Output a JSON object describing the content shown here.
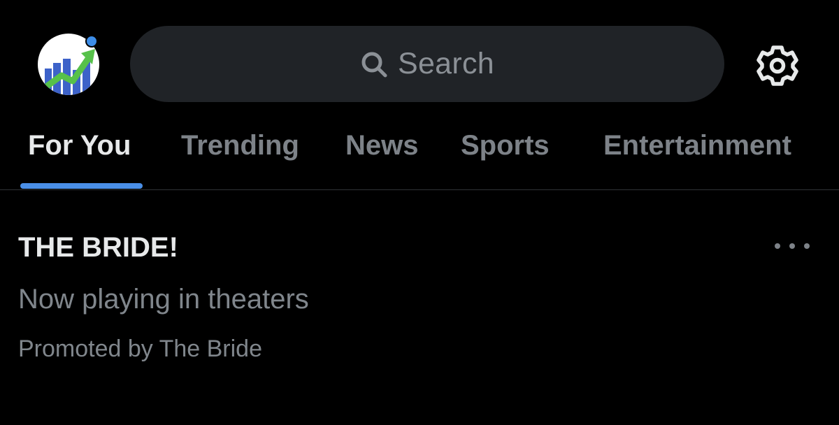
{
  "header": {
    "search": {
      "placeholder": "Search",
      "icon": "search-icon"
    },
    "settings_icon": "gear-icon",
    "avatar_icon": "growth-chart-avatar"
  },
  "tabs": [
    {
      "label": "For You",
      "active": true
    },
    {
      "label": "Trending",
      "active": false
    },
    {
      "label": "News",
      "active": false
    },
    {
      "label": "Sports",
      "active": false
    },
    {
      "label": "Entertainment",
      "active": false
    }
  ],
  "trend": {
    "title": "THE BRIDE!",
    "subtitle": "Now playing in theaters",
    "promoted": "Promoted by The Bride",
    "more_icon": "more-options-icon"
  },
  "colors": {
    "background": "#000000",
    "search_bg": "#202327",
    "accent": "#4a8fe7",
    "muted_text": "#80868c",
    "primary_text": "#e7e9ea"
  }
}
